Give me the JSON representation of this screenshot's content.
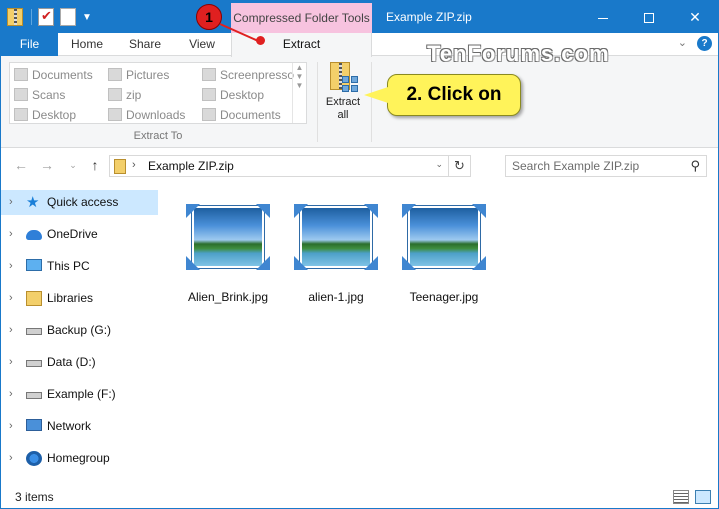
{
  "window": {
    "title": "Example ZIP.zip",
    "contextual_tab_group": "Compressed Folder Tools"
  },
  "ribbon_tabs": {
    "file": "File",
    "home": "Home",
    "share": "Share",
    "view": "View",
    "extract": "Extract"
  },
  "ribbon": {
    "destinations": [
      "Documents",
      "Pictures",
      "Screenpresso",
      "Scans",
      "zip",
      "Desktop",
      "Desktop",
      "Downloads",
      "Documents"
    ],
    "group_label": "Extract To",
    "extract_all_line1": "Extract",
    "extract_all_line2": "all"
  },
  "watermark": "TenForums.com",
  "annotations": {
    "step1_badge": "1",
    "step2_callout": "2. Click on"
  },
  "address_bar": {
    "path": "Example ZIP.zip",
    "search_placeholder": "Search Example ZIP.zip"
  },
  "nav_pane": {
    "items": [
      {
        "label": "Quick access",
        "icon": "star-icon"
      },
      {
        "label": "OneDrive",
        "icon": "cloud-icon"
      },
      {
        "label": "This PC",
        "icon": "computer-icon"
      },
      {
        "label": "Libraries",
        "icon": "library-icon"
      },
      {
        "label": "Backup (G:)",
        "icon": "drive-icon"
      },
      {
        "label": "Data (D:)",
        "icon": "drive-icon"
      },
      {
        "label": "Example (F:)",
        "icon": "drive-icon"
      },
      {
        "label": "Network",
        "icon": "network-icon"
      },
      {
        "label": "Homegroup",
        "icon": "homegroup-icon"
      }
    ]
  },
  "files": [
    {
      "name": "Alien_Brink.jpg"
    },
    {
      "name": "alien-1.jpg"
    },
    {
      "name": "Teenager.jpg"
    }
  ],
  "status": {
    "item_count": "3 items"
  },
  "colors": {
    "accent": "#1979ca",
    "contextual_tab": "#f7c3df",
    "selection": "#cce8ff",
    "callout": "#fff35a",
    "annotation_red": "#e02020"
  }
}
